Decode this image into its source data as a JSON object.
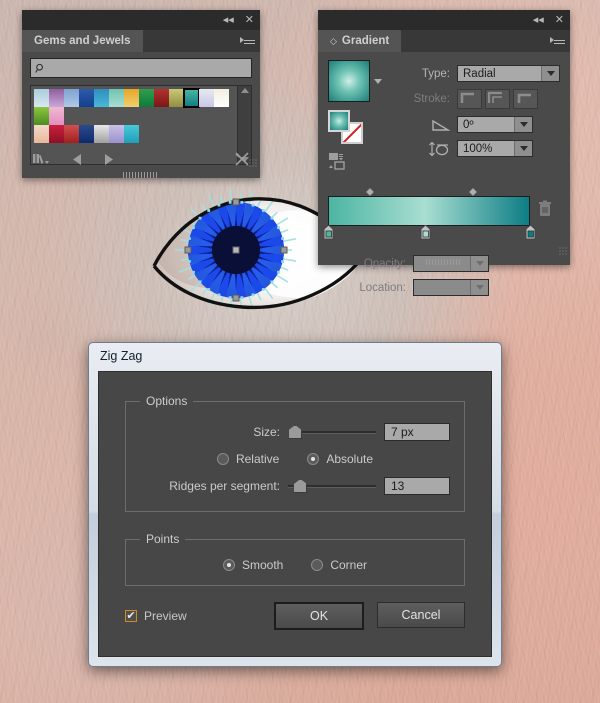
{
  "background": {
    "description": "photograph of a human eye with skin texture",
    "artwork_name": "zigzag-iris-eye"
  },
  "swatch_panel": {
    "tab_label": "Gems and Jewels",
    "collapse_icon": "collapse-double-arrow-icon",
    "close_icon": "close-icon",
    "menu_icon": "panel-menu-icon",
    "search": {
      "value": "",
      "placeholder": "",
      "icon": "search-icon"
    },
    "footer": {
      "library_label": "swatch-libraries-menu",
      "prev_label": "previous-swatch-set",
      "next_label": "next-swatch-set",
      "delete_label": "delete-swatch"
    },
    "swatches_row1": [
      "#a9cddc",
      "#8f5ea0",
      "#7ea3d0",
      "#2e5ba8",
      "#2f8fbe",
      "#6fc3b4",
      "#e8a628",
      "#2f9e4f",
      "#b43030",
      "#c9c878",
      "#4cb5a2",
      "#e8e8f0",
      "#f2efe0",
      "#8cc63f",
      "#f0b8d0"
    ],
    "swatches_row1_end": [
      "#d8e8f0",
      "#c9a8d8",
      "#b0c8e8",
      "#123f8f",
      "#49b8d8",
      "#a9ded2",
      "#f0d070",
      "#0f7a3a",
      "#7a1818",
      "#8f8f40",
      "#0d7d85",
      "#c8c8e8",
      "#ffffff",
      "#4a8c1f",
      "#e090c0"
    ],
    "swatches_row2": [
      "#f4d9c8",
      "#c8203c",
      "#d05050",
      "#2a4a8c",
      "#e8e8e8",
      "#c8c0e8",
      "#49c8d8"
    ],
    "swatches_row2_end": [
      "#e8b89a",
      "#8f0f28",
      "#a02020",
      "#0f2a6c",
      "#a0a0a0",
      "#9a90d0",
      "#1fa0b8"
    ],
    "selected_index": 10
  },
  "gradient_panel": {
    "tab_label": "Gradient",
    "collapse_icon": "collapse-double-arrow-icon",
    "close_icon": "close-icon",
    "menu_icon": "panel-menu-icon",
    "type_label": "Type:",
    "type_value": "Radial",
    "stroke_label": "Stroke:",
    "stroke_buttons": [
      "stroke-within",
      "stroke-across",
      "stroke-along"
    ],
    "angle_label_icon": "gradient-angle-icon",
    "angle_value": "0º",
    "aspect_label_icon": "gradient-aspect-ratio-icon",
    "aspect_value": "100%",
    "opacity_label": "Opacity:",
    "opacity_value": "",
    "location_label": "Location:",
    "location_value": "",
    "delete_stop_icon": "trash-icon",
    "gradient_stops": [
      {
        "color": "#4cb5a2",
        "position": 0
      },
      {
        "color": "#a9ded2",
        "position": 48
      },
      {
        "color": "#0d7d85",
        "position": 100
      }
    ],
    "midpoints": [
      21,
      72
    ],
    "thumbnail_icon": "radial-gradient-thumbnail",
    "fill_stroke_icon": "fill-stroke-swatches",
    "gradient_fill_icon": "gradient-fill-type-icon"
  },
  "zigzag_dialog": {
    "title": "Zig Zag",
    "options_legend": "Options",
    "size_label": "Size:",
    "size_value": "7 px",
    "size_slider_pct": 7,
    "relative_label": "Relative",
    "absolute_label": "Absolute",
    "size_mode": "Absolute",
    "ridges_label": "Ridges per segment:",
    "ridges_value": "13",
    "ridges_slider_pct": 13,
    "points_legend": "Points",
    "smooth_label": "Smooth",
    "corner_label": "Corner",
    "points_mode": "Smooth",
    "preview_label": "Preview",
    "preview_checked": true,
    "preview_check_glyph": "✔",
    "ok_label": "OK",
    "cancel_label": "Cancel"
  },
  "colors": {
    "panel_bg": "#4a4a4a",
    "panel_titlebar": "#2b2b2b",
    "dialog_title_bg": "#dbe3ec",
    "accent_teal": "#4cb5a2",
    "iris_blue": "#1a38d8",
    "preview_check_border": "#d08a22"
  }
}
